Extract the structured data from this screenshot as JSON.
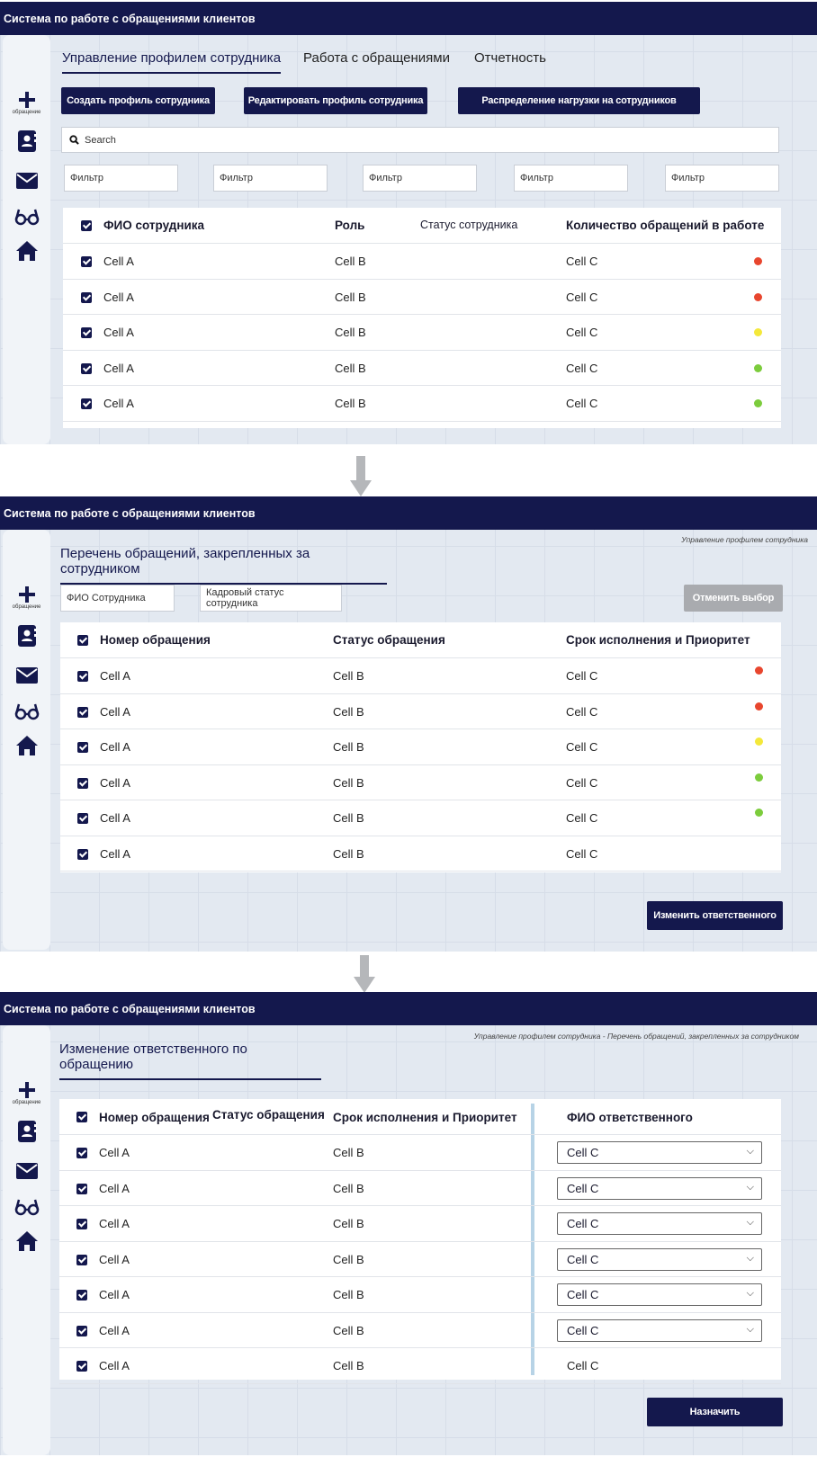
{
  "app_title": "Система по работе с обращениями клиентов",
  "sidebar": {
    "add_label": "обращение"
  },
  "colors": {
    "navy": "#14184d",
    "red": "#e8462e",
    "yellow": "#f4e83a",
    "green": "#7ccc3c"
  },
  "screen1": {
    "tabs": [
      "Управление профилем сотрудника",
      "Работа с обращениями",
      "Отчетность"
    ],
    "buttons": [
      "Создать профиль сотрудника",
      "Редактировать профиль сотрудника",
      "Распределение нагрузки на сотрудников"
    ],
    "search_placeholder": "Search",
    "filters": [
      "Фильтр",
      "Фильтр",
      "Фильтр",
      "Фильтр",
      "Фильтр"
    ],
    "columns": [
      "ФИО сотрудника",
      "Роль",
      "Статус сотрудника",
      "Количество обращений в работе"
    ],
    "rows": [
      {
        "a": "Cell A",
        "b": "Cell B",
        "c": "Cell C",
        "status": "red"
      },
      {
        "a": "Cell A",
        "b": "Cell B",
        "c": "Cell C",
        "status": "red"
      },
      {
        "a": "Cell A",
        "b": "Cell B",
        "c": "Cell C",
        "status": "yellow"
      },
      {
        "a": "Cell A",
        "b": "Cell B",
        "c": "Cell C",
        "status": "green"
      },
      {
        "a": "Cell A",
        "b": "Cell B",
        "c": "Cell C",
        "status": "green"
      }
    ]
  },
  "screen2": {
    "breadcrumb": "Управление профилем сотрудника",
    "title": "Перечень обращений, закрепленных за сотрудником",
    "field_name": "ФИО Сотрудника",
    "field_status": "Кадровый статус сотрудника",
    "cancel_button": "Отменить выбор",
    "columns": [
      "Номер обращения",
      "Статус обращения",
      "Срок исполнения и Приоритет"
    ],
    "rows": [
      {
        "a": "Cell A",
        "b": "Cell B",
        "c": "Cell C",
        "status": "red"
      },
      {
        "a": "Cell A",
        "b": "Cell B",
        "c": "Cell C",
        "status": "red"
      },
      {
        "a": "Cell A",
        "b": "Cell B",
        "c": "Cell C",
        "status": "yellow"
      },
      {
        "a": "Cell A",
        "b": "Cell B",
        "c": "Cell C",
        "status": "green"
      },
      {
        "a": "Cell A",
        "b": "Cell B",
        "c": "Cell C",
        "status": "green"
      },
      {
        "a": "Cell A",
        "b": "Cell B",
        "c": "Cell C",
        "status": ""
      }
    ],
    "change_button": "Изменить ответственного"
  },
  "screen3": {
    "breadcrumb": "Управление профилем сотрудника - Перечень обращений, закрепленных за сотрудником",
    "title": "Изменение ответственного по обращению",
    "columns": [
      "Номер обращения",
      "Статус обращения",
      "Срок исполнения и Приоритет",
      "ФИО ответственного"
    ],
    "rows": [
      {
        "a": "Cell A",
        "b": "Cell B",
        "c": "Cell C",
        "dropdown": true
      },
      {
        "a": "Cell A",
        "b": "Cell B",
        "c": "Cell C",
        "dropdown": true
      },
      {
        "a": "Cell A",
        "b": "Cell B",
        "c": "Cell C",
        "dropdown": true
      },
      {
        "a": "Cell A",
        "b": "Cell B",
        "c": "Cell C",
        "dropdown": true
      },
      {
        "a": "Cell A",
        "b": "Cell B",
        "c": "Cell C",
        "dropdown": true
      },
      {
        "a": "Cell A",
        "b": "Cell B",
        "c": "Cell C",
        "dropdown": true
      },
      {
        "a": "Cell A",
        "b": "Cell B",
        "c": "Cell C",
        "dropdown": false
      }
    ],
    "assign_button": "Назначить"
  }
}
